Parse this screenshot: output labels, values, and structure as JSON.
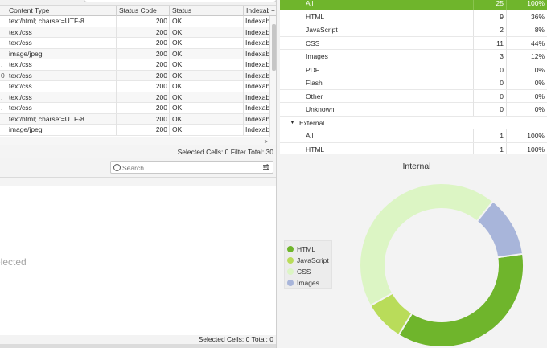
{
  "crawl_table": {
    "columns": [
      "Content Type",
      "Status Code",
      "Status",
      "Indexab"
    ],
    "add_column_symbol": "+",
    "rows": [
      {
        "lead": "",
        "content_type": "text/html; charset=UTF-8",
        "status_code": "200",
        "status": "OK",
        "indexability": "Indexab"
      },
      {
        "lead": "",
        "content_type": "text/css",
        "status_code": "200",
        "status": "OK",
        "indexability": "Indexab"
      },
      {
        "lead": "",
        "content_type": "text/css",
        "status_code": "200",
        "status": "OK",
        "indexability": "Indexab"
      },
      {
        "lead": "",
        "content_type": "image/jpeg",
        "status_code": "200",
        "status": "OK",
        "indexability": "Indexab"
      },
      {
        "lead": ".",
        "content_type": "text/css",
        "status_code": "200",
        "status": "OK",
        "indexability": "Indexab"
      },
      {
        "lead": "0",
        "content_type": "text/css",
        "status_code": "200",
        "status": "OK",
        "indexability": "Indexab"
      },
      {
        "lead": ".",
        "content_type": "text/css",
        "status_code": "200",
        "status": "OK",
        "indexability": "Indexab"
      },
      {
        "lead": ".",
        "content_type": "text/css",
        "status_code": "200",
        "status": "OK",
        "indexability": "Indexab"
      },
      {
        "lead": ".",
        "content_type": "text/css",
        "status_code": "200",
        "status": "OK",
        "indexability": "Indexab"
      },
      {
        "lead": "",
        "content_type": "text/html; charset=UTF-8",
        "status_code": "200",
        "status": "OK",
        "indexability": "Indexab"
      },
      {
        "lead": "",
        "content_type": "image/jpeg",
        "status_code": "200",
        "status": "OK",
        "indexability": "Indexab"
      }
    ],
    "footer": "Selected Cells:  0  Filter Total:  30"
  },
  "overview_tree": {
    "rows": [
      {
        "label": "All",
        "count": "25",
        "percent": "100%",
        "selected": true
      },
      {
        "label": "HTML",
        "count": "9",
        "percent": "36%"
      },
      {
        "label": "JavaScript",
        "count": "2",
        "percent": "8%"
      },
      {
        "label": "CSS",
        "count": "11",
        "percent": "44%"
      },
      {
        "label": "Images",
        "count": "3",
        "percent": "12%"
      },
      {
        "label": "PDF",
        "count": "0",
        "percent": "0%"
      },
      {
        "label": "Flash",
        "count": "0",
        "percent": "0%"
      },
      {
        "label": "Other",
        "count": "0",
        "percent": "0%"
      },
      {
        "label": "Unknown",
        "count": "0",
        "percent": "0%"
      },
      {
        "label": "External",
        "count": "",
        "percent": "",
        "group": true
      },
      {
        "label": "All",
        "count": "1",
        "percent": "100%"
      },
      {
        "label": "HTML",
        "count": "1",
        "percent": "100%"
      }
    ],
    "caret_symbol": "▼"
  },
  "details_panel": {
    "search_placeholder": "Search...",
    "empty_message": "selected",
    "footer": "Selected Cells:  0  Total:  0"
  },
  "chart_data": {
    "type": "pie",
    "title": "Internal",
    "categories": [
      "HTML",
      "JavaScript",
      "CSS",
      "Images"
    ],
    "values": [
      9,
      2,
      11,
      3
    ],
    "colors": [
      "#6fb52c",
      "#b9dc5a",
      "#dcf5c4",
      "#a8b5da"
    ],
    "legend": "left"
  },
  "colors": {
    "accent": "#6fb52c"
  }
}
